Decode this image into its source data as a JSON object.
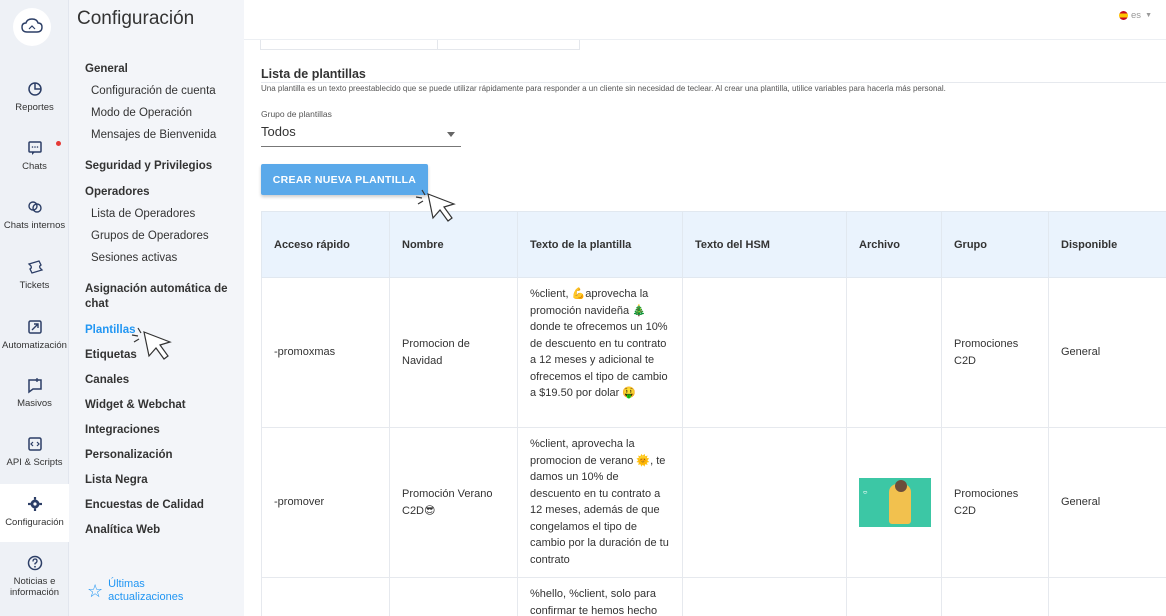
{
  "rail": {
    "items": [
      {
        "label": "Reportes",
        "icon": "chart-pie-icon"
      },
      {
        "label": "Chats",
        "icon": "chat-bubble-icon"
      },
      {
        "label": "Chats internos",
        "icon": "internal-chat-icon"
      },
      {
        "label": "Tickets",
        "icon": "ticket-icon"
      },
      {
        "label": "Automatización",
        "icon": "automation-icon"
      },
      {
        "label": "Masivos",
        "icon": "broadcast-icon"
      },
      {
        "label": "API & Scripts",
        "icon": "code-icon"
      },
      {
        "label": "Configuración",
        "icon": "gear-icon"
      },
      {
        "label": "Noticias e información",
        "icon": "help-icon"
      }
    ]
  },
  "sidebar": {
    "title": "Configuración",
    "general": "General",
    "general_items": [
      "Configuración de cuenta",
      "Modo de Operación",
      "Mensajes de Bienvenida"
    ],
    "security": "Seguridad y Privilegios",
    "operators": "Operadores",
    "operators_items": [
      "Lista de Operadores",
      "Grupos de Operadores",
      "Sesiones activas"
    ],
    "auto_assign": "Asignación automática de chat",
    "templates": "Plantillas",
    "tags": "Etiquetas",
    "channels": "Canales",
    "widget": "Widget & Webchat",
    "integrations": "Integraciones",
    "customization": "Personalización",
    "blacklist": "Lista Negra",
    "surveys": "Encuestas de Calidad",
    "analytics": "Analítica Web",
    "footer": "Últimas actualizaciones"
  },
  "topbar": {
    "lang": "es"
  },
  "main": {
    "title": "Lista de plantillas",
    "description": "Una plantilla es un texto preestablecido que se puede utilizar rápidamente para responder a un cliente sin necesidad de teclear. Al crear una plantilla, utilice variables para hacerla más personal.",
    "group_label": "Grupo de plantillas",
    "group_value": "Todos",
    "create_button": "CREAR NUEVA PLANTILLA"
  },
  "table": {
    "headers": [
      "Acceso rápido",
      "Nombre",
      "Texto de la plantilla",
      "Texto del HSM",
      "Archivo",
      "Grupo",
      "Disponible"
    ],
    "rows": [
      {
        "shortcut": "-promoxmas",
        "name": "Promocion de Navidad",
        "text": "%client, 💪aprovecha la promoción navideña 🎄 donde te ofrecemos un 10% de descuento en tu contrato a 12 meses y adicional te ofrecemos el tipo de cambio a $19.50 por dolar 🤑",
        "hsm": "",
        "group": "Promociones C2D",
        "available": "General"
      },
      {
        "shortcut": "-promover",
        "name": "Promoción Verano C2D😎",
        "text": "%client, aprovecha la promocion de verano 🌞, te damos un 10% de descuento en tu contrato a 12 meses, además de que congelamos el tipo de cambio por la duración de tu contrato",
        "hsm": "",
        "group": "Promociones C2D",
        "available": "General"
      },
      {
        "shortcut": "",
        "name": "",
        "text": "%hello, %client, solo para confirmar te hemos hecho",
        "hsm": "",
        "group": "",
        "available": ""
      }
    ]
  },
  "colors": {
    "accent": "#2196f3",
    "button": "#5aa9ea",
    "header_bg": "#eaf3fd"
  }
}
